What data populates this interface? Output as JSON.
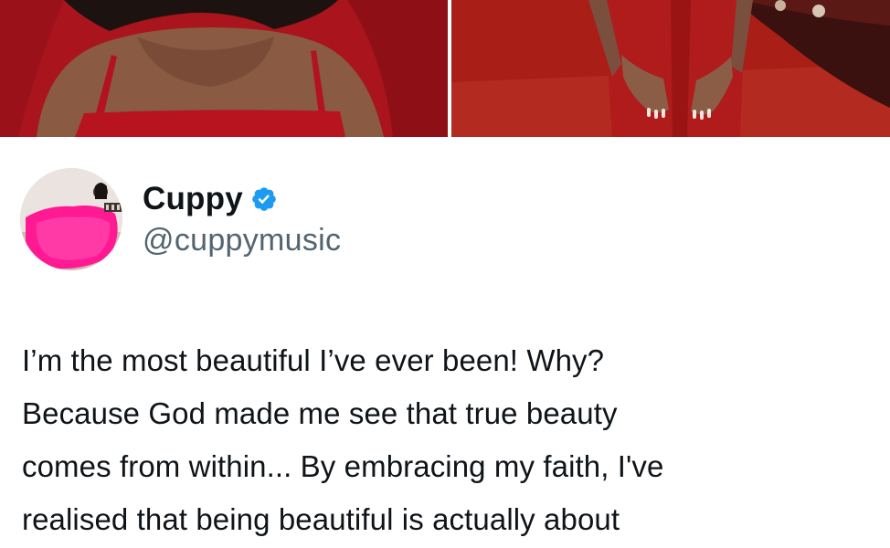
{
  "photos": [
    {
      "name": "photo-left",
      "description": ""
    },
    {
      "name": "photo-right",
      "description": ""
    }
  ],
  "author": {
    "display_name": "Cuppy",
    "handle": "@cuppymusic",
    "verified": true
  },
  "colors": {
    "text": "#0f1419",
    "secondary": "#536471",
    "verified": "#1d9bf0",
    "dress_red": "#a3121c"
  },
  "tweet": {
    "text": "I’m the most beautiful I’ve ever been! Why?\nBecause God made me see that true beauty\ncomes from within... By embracing my faith, I've\nrealised that being beautiful is actually about"
  }
}
